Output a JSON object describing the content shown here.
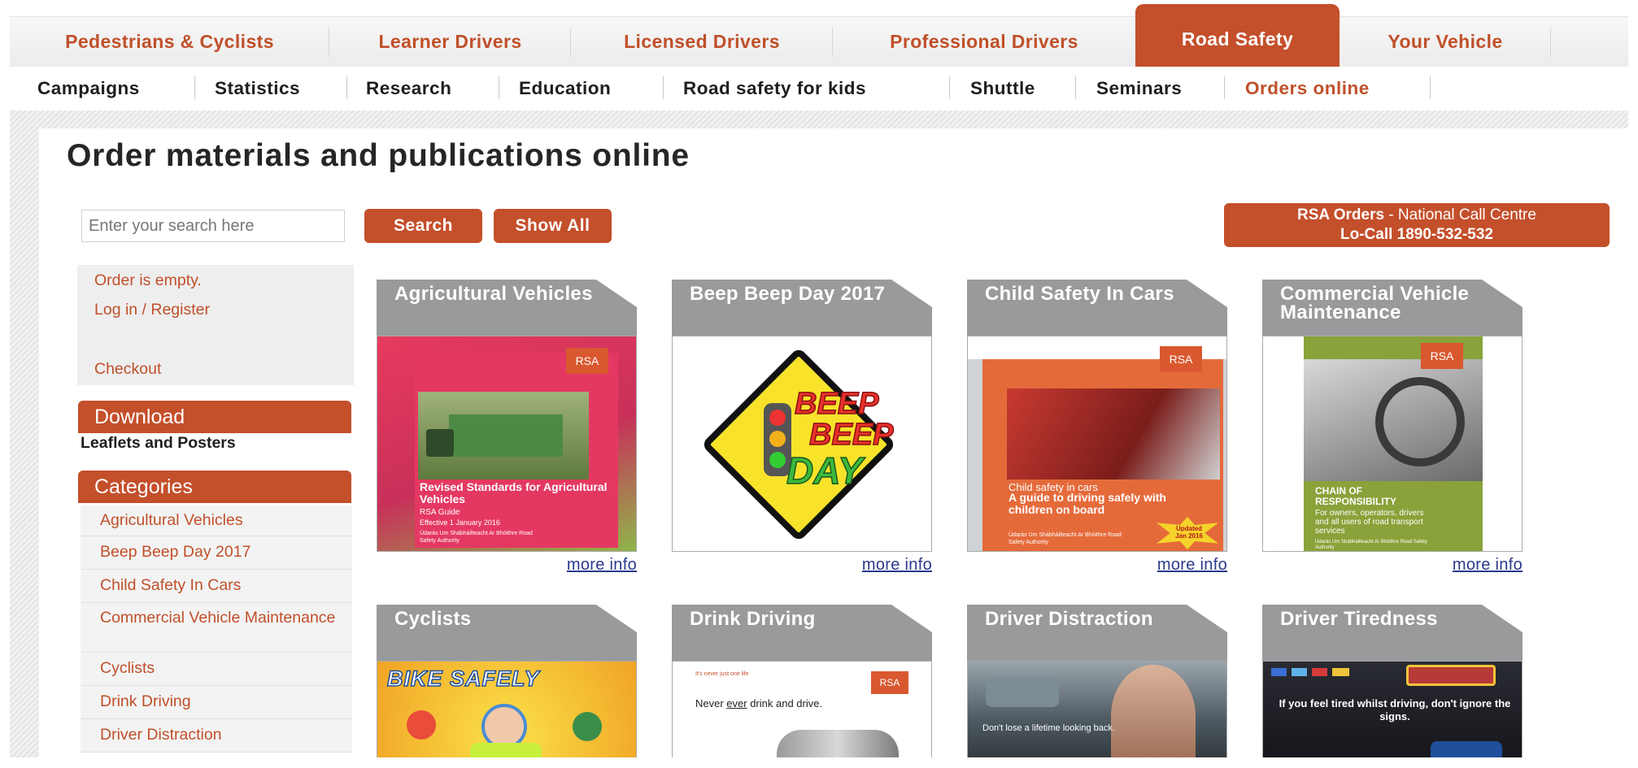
{
  "top_tabs": [
    {
      "label": "Pedestrians & Cyclists"
    },
    {
      "label": "Learner Drivers"
    },
    {
      "label": "Licensed Drivers"
    },
    {
      "label": "Professional Drivers"
    },
    {
      "label": "Road Safety",
      "active": true
    },
    {
      "label": "Your Vehicle"
    }
  ],
  "sub_nav": [
    {
      "label": "Campaigns"
    },
    {
      "label": "Statistics"
    },
    {
      "label": "Research"
    },
    {
      "label": "Education"
    },
    {
      "label": "Road safety for kids"
    },
    {
      "label": "Shuttle"
    },
    {
      "label": "Seminars"
    },
    {
      "label": "Orders online",
      "active": true
    }
  ],
  "page_title": "Order materials and publications online",
  "search": {
    "placeholder": "Enter your search here",
    "search_label": "Search",
    "show_all_label": "Show All"
  },
  "call_centre": {
    "line1_bold": "RSA Orders",
    "line1_rest": " - National Call Centre",
    "line2": "Lo-Call 1890-532-532"
  },
  "order_box": {
    "status": "Order is empty.",
    "login": "Log in / Register",
    "checkout": "Checkout"
  },
  "download": {
    "header": "Download",
    "item": "Leaflets and Posters"
  },
  "categories": {
    "header": "Categories",
    "items": [
      "Agricultural Vehicles",
      "Beep Beep Day 2017",
      "Child Safety In Cars",
      "Commercial Vehicle Maintenance",
      "Cyclists",
      "Drink Driving",
      "Driver Distraction"
    ]
  },
  "products": [
    {
      "title": "Agricultural Vehicles",
      "more": "more info",
      "cover": {
        "brand": "RSA",
        "heading": "Revised Standards for Agricultural Vehicles",
        "sub": "RSA Guide",
        "note": "Effective 1 January 2016",
        "org": "Údarás Um Shábháilteacht Ar Bhóithre Road Safety Authority"
      }
    },
    {
      "title": "Beep Beep Day 2017",
      "more": "more info",
      "cover": {
        "line1": "BEEP",
        "line2": "BEEP",
        "line3": "DAY"
      }
    },
    {
      "title": "Child Safety In Cars",
      "more": "more info",
      "cover": {
        "brand": "RSA",
        "heading": "Child safety in cars",
        "sub": "A guide to driving safely with children on board",
        "org": "Údarás Um Shábháilteacht Ar Bhóithre Road Safety Authority",
        "badge": "Updated Jan 2016"
      }
    },
    {
      "title": "Commercial Vehicle Maintenance",
      "more": "more info",
      "cover": {
        "brand": "RSA",
        "heading": "CHAIN OF RESPONSIBILITY",
        "sub": "For owners, operators, drivers and all users of road transport services",
        "org": "Údarás Um Shábháilteacht Ar Bhóithre Road Safety Authority"
      }
    },
    {
      "title": "Cyclists",
      "more": "",
      "cover": {
        "heading": "BIKE SAFELY"
      }
    },
    {
      "title": "Drink Driving",
      "more": "",
      "cover": {
        "brand": "RSA",
        "tagline": "It's never just one life",
        "heading_pre": "Never ",
        "heading_em": "ever",
        "heading_post": " drink and drive."
      }
    },
    {
      "title": "Driver Distraction",
      "more": "",
      "cover": {
        "heading": "Don't lose a lifetime looking back."
      }
    },
    {
      "title": "Driver Tiredness",
      "more": "",
      "cover": {
        "heading": "If you feel tired whilst driving, don't ignore the signs."
      }
    }
  ]
}
